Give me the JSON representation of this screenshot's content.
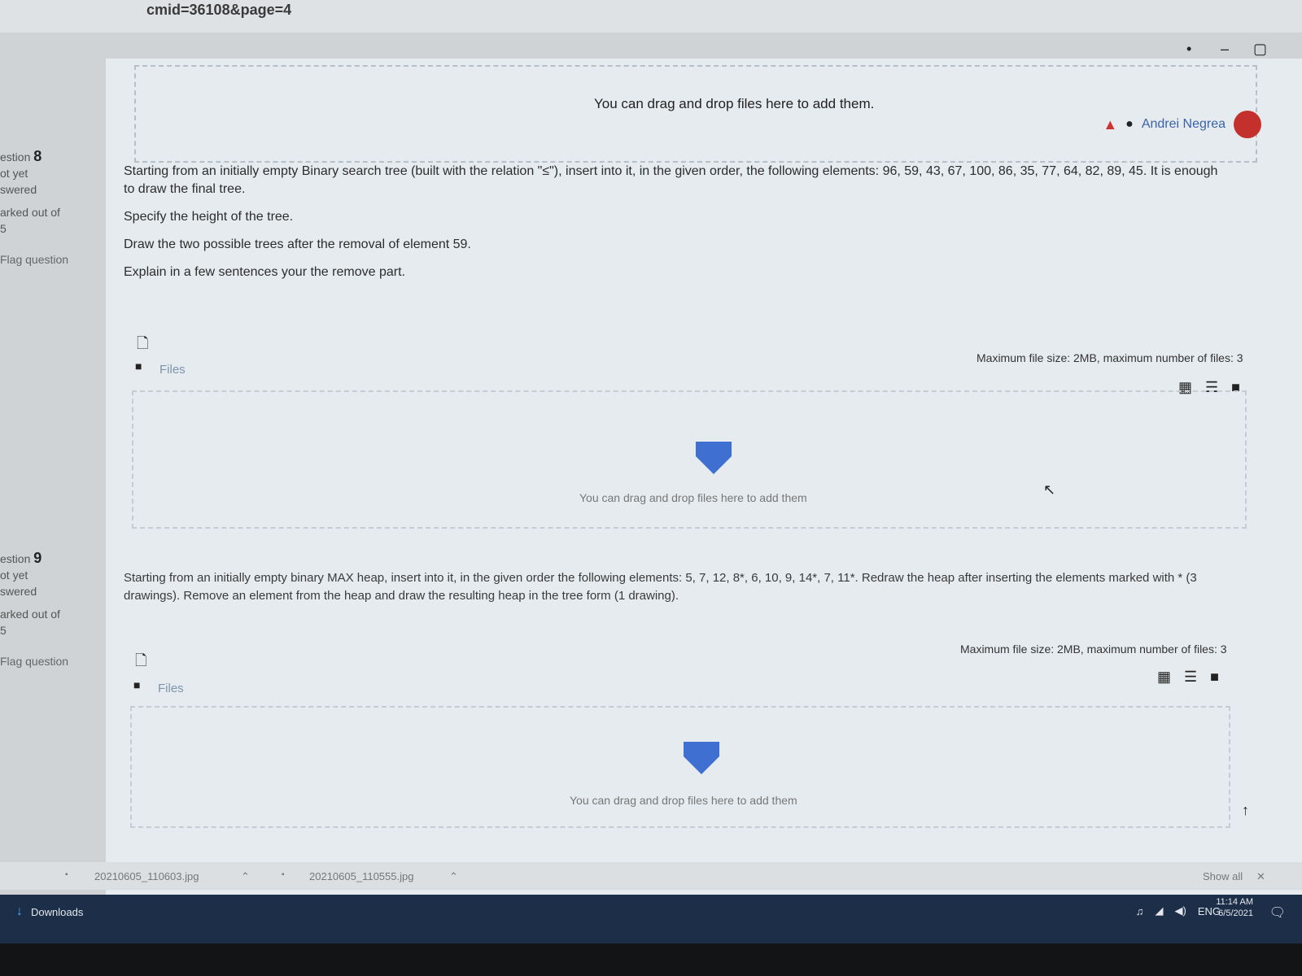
{
  "browser": {
    "url_fragment": "cmid=36108&page=4",
    "window_controls": [
      "•",
      "–",
      "▢"
    ],
    "toolbar_icons": [
      "☆",
      "●",
      "►",
      "▣",
      "★",
      "●"
    ]
  },
  "header": {
    "drop_text": "You can drag and drop files here to add them.",
    "user_name": "Andrei Negrea"
  },
  "questions": [
    {
      "label_prefix": "estion",
      "number": "8",
      "status_1": "ot yet",
      "status_2": "swered",
      "marked": "arked out of",
      "marked_value": "5",
      "flag": "Flag question",
      "paragraph_1": "Starting from an initially empty Binary search tree (built with the relation \"≤\"), insert into it, in the given order, the following elements: 96, 59, 43, 67, 100, 86, 35, 77, 64, 82, 89, 45. It is enough to draw the final tree.",
      "paragraph_2": "Specify the height of the tree.",
      "paragraph_3": "Draw the two possible trees after the removal of element 59.",
      "paragraph_4": "Explain in a few sentences your the remove part.",
      "limit_text": "Maximum file size: 2MB, maximum number of files: 3",
      "files_label": "Files",
      "dropzone_text": "You can drag and drop files here to add them"
    },
    {
      "label_prefix": "estion",
      "number": "9",
      "status_1": "ot yet",
      "status_2": "swered",
      "marked": "arked out of",
      "marked_value": "5",
      "flag": "Flag question",
      "paragraph_1": "Starting from an initially empty binary MAX heap, insert into it, in the given order the following elements: 5, 7, 12, 8*, 6, 10, 9, 14*, 7, 11*. Redraw the heap after inserting the elements marked with * (3 drawings). Remove an element from the heap and draw the resulting heap in the tree form (1 drawing).",
      "limit_text": "Maximum file size: 2MB, maximum number of files: 3",
      "files_label": "Files",
      "dropzone_text": "You can drag and drop files here to add them"
    }
  ],
  "downloads": [
    {
      "name": "20210605_110603.jpg"
    },
    {
      "name": "20210605_110555.jpg"
    }
  ],
  "download_show_all": "Show all",
  "taskbar": {
    "start_label": "Downloads",
    "language": "ENG",
    "time": "11:14 AM",
    "date": "6/5/2021"
  }
}
